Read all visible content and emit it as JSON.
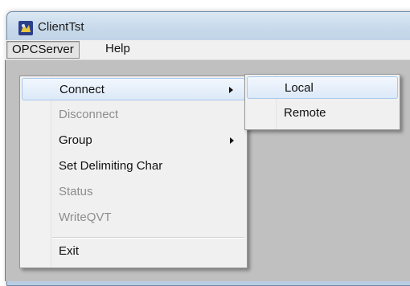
{
  "window": {
    "title": "ClientTst"
  },
  "menubar": {
    "items": [
      {
        "label": "OPCServer"
      },
      {
        "label": "Help"
      }
    ]
  },
  "opcserver_menu": {
    "items": [
      {
        "label": "Connect",
        "submenu": true,
        "enabled": true
      },
      {
        "label": "Disconnect",
        "submenu": false,
        "enabled": false
      },
      {
        "label": "Group",
        "submenu": true,
        "enabled": true
      },
      {
        "label": "Set Delimiting Char",
        "submenu": false,
        "enabled": true
      },
      {
        "label": "Status",
        "submenu": false,
        "enabled": false
      },
      {
        "label": "WriteQVT",
        "submenu": false,
        "enabled": false
      },
      {
        "label": "Exit",
        "submenu": false,
        "enabled": true
      }
    ]
  },
  "connect_submenu": {
    "items": [
      {
        "label": "Local"
      },
      {
        "label": "Remote"
      }
    ]
  },
  "icons": {
    "app": "app-icon",
    "submenu": "submenu-arrow-icon"
  },
  "colors": {
    "highlight": "#dce9f8",
    "disabled_text": "#8d8d8d",
    "client_area": "#c0c0c0"
  }
}
